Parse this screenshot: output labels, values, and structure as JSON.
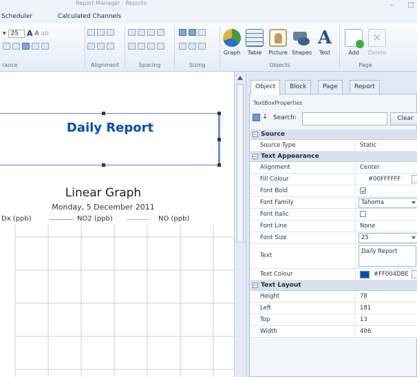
{
  "window": {
    "faded_title": "Report Manager - Reports",
    "tabs": [
      "Scheduler",
      "Calculated Channels"
    ],
    "controls": [
      "–",
      "□"
    ]
  },
  "ribbon": {
    "font_size": "25",
    "font_controls": [
      "A",
      "A",
      "ab"
    ],
    "groups": {
      "font": "rance",
      "alignment": "Alignment",
      "spacing": "Spacing",
      "sizing": "Sizing",
      "objects": "Objects",
      "page": "Page"
    },
    "objects": [
      {
        "label": "Graph",
        "icon": "graph-icon"
      },
      {
        "label": "Table",
        "icon": "table-icon"
      },
      {
        "label": "Picture",
        "icon": "picture-icon"
      },
      {
        "label": "Shapes",
        "icon": "shapes-icon"
      },
      {
        "label": "Text",
        "icon": "text-icon"
      }
    ],
    "page_buttons": [
      {
        "label": "Add",
        "icon": "add-page-icon"
      },
      {
        "label": "Delete",
        "icon": "delete-page-icon"
      }
    ]
  },
  "canvas": {
    "report_title": "Daily Report",
    "report_title_color": "#004DBE",
    "graph_title": "Linear Graph",
    "graph_subtitle": "Monday, 5 December 2011",
    "legend": [
      {
        "label": "Dx (ppb)",
        "color": "#ffffff"
      },
      {
        "label": "NO2 (ppb)",
        "color": "#8a9fc4"
      },
      {
        "label": "NO (ppb)",
        "color": "#8fcfa8"
      }
    ]
  },
  "panel": {
    "tabs": [
      "Object",
      "Block",
      "Page",
      "Report"
    ],
    "active_tab": "Object",
    "props_type": "TextBoxProperties",
    "search_label": "Search:",
    "search_value": "",
    "clear_label": "Clear",
    "categories": [
      {
        "name": "Source",
        "rows": [
          {
            "name": "Source Type",
            "value": "Static"
          }
        ]
      },
      {
        "name": "Text Appearance",
        "rows": [
          {
            "name": "Alignment",
            "value": "Center"
          },
          {
            "name": "Fill Colour",
            "value": "#00FFFFFF"
          },
          {
            "name": "Font Bold",
            "value": "true"
          },
          {
            "name": "Font Family",
            "value": "Tahoma"
          },
          {
            "name": "Font Italic",
            "value": "false"
          },
          {
            "name": "Font Line",
            "value": "None"
          },
          {
            "name": "Font Size",
            "value": "25"
          },
          {
            "name": "Text",
            "value": "Daily Report"
          },
          {
            "name": "Text Colour",
            "value": "#FF004DBE"
          }
        ]
      },
      {
        "name": "Text Layout",
        "rows": [
          {
            "name": "Height",
            "value": "78"
          },
          {
            "name": "Left",
            "value": "181"
          },
          {
            "name": "Top",
            "value": "13"
          },
          {
            "name": "Width",
            "value": "406"
          }
        ]
      }
    ],
    "text_colour_swatch": "#004DBE"
  }
}
